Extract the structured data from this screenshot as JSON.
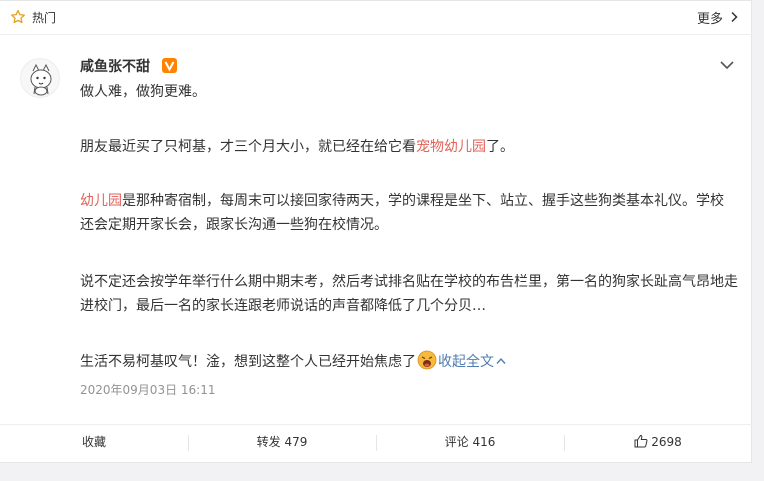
{
  "header": {
    "hot_label": "热门",
    "more_label": "更多"
  },
  "post": {
    "username": "咸鱼张不甜",
    "paragraphs": {
      "p1": "做人难，做狗更难。",
      "p2_before": "朋友最近买了只柯基，才三个月大小，就已经在给它看",
      "p2_link": "宠物幼儿园",
      "p2_after": "了。",
      "p3_link": "幼儿园",
      "p3_after": "是那种寄宿制，每周末可以接回家待两天，学的课程是坐下、站立、握手这些狗类基本礼仪。学校还会定期开家长会，跟家长沟通一些狗在校情况。",
      "p4": "说不定还会按学年举行什么期中期末考，然后考试排名贴在学校的布告栏里，第一名的狗家长趾高气昂地走进校门，最后一名的家长连跟老师说话的声音都降低了几个分贝…",
      "p5_before": "生活不易柯基叹气！淦，想到这整个人已经开始焦虑了",
      "p5_collapse": "收起全文"
    },
    "timestamp": "2020年09月03日 16:11"
  },
  "footer": {
    "favorite": "收藏",
    "repost": "转发 479",
    "comment": "评论 416",
    "like": "2698"
  },
  "colors": {
    "link_red": "#e0635a",
    "link_blue": "#507daf",
    "badge_orange": "#ff8200"
  }
}
